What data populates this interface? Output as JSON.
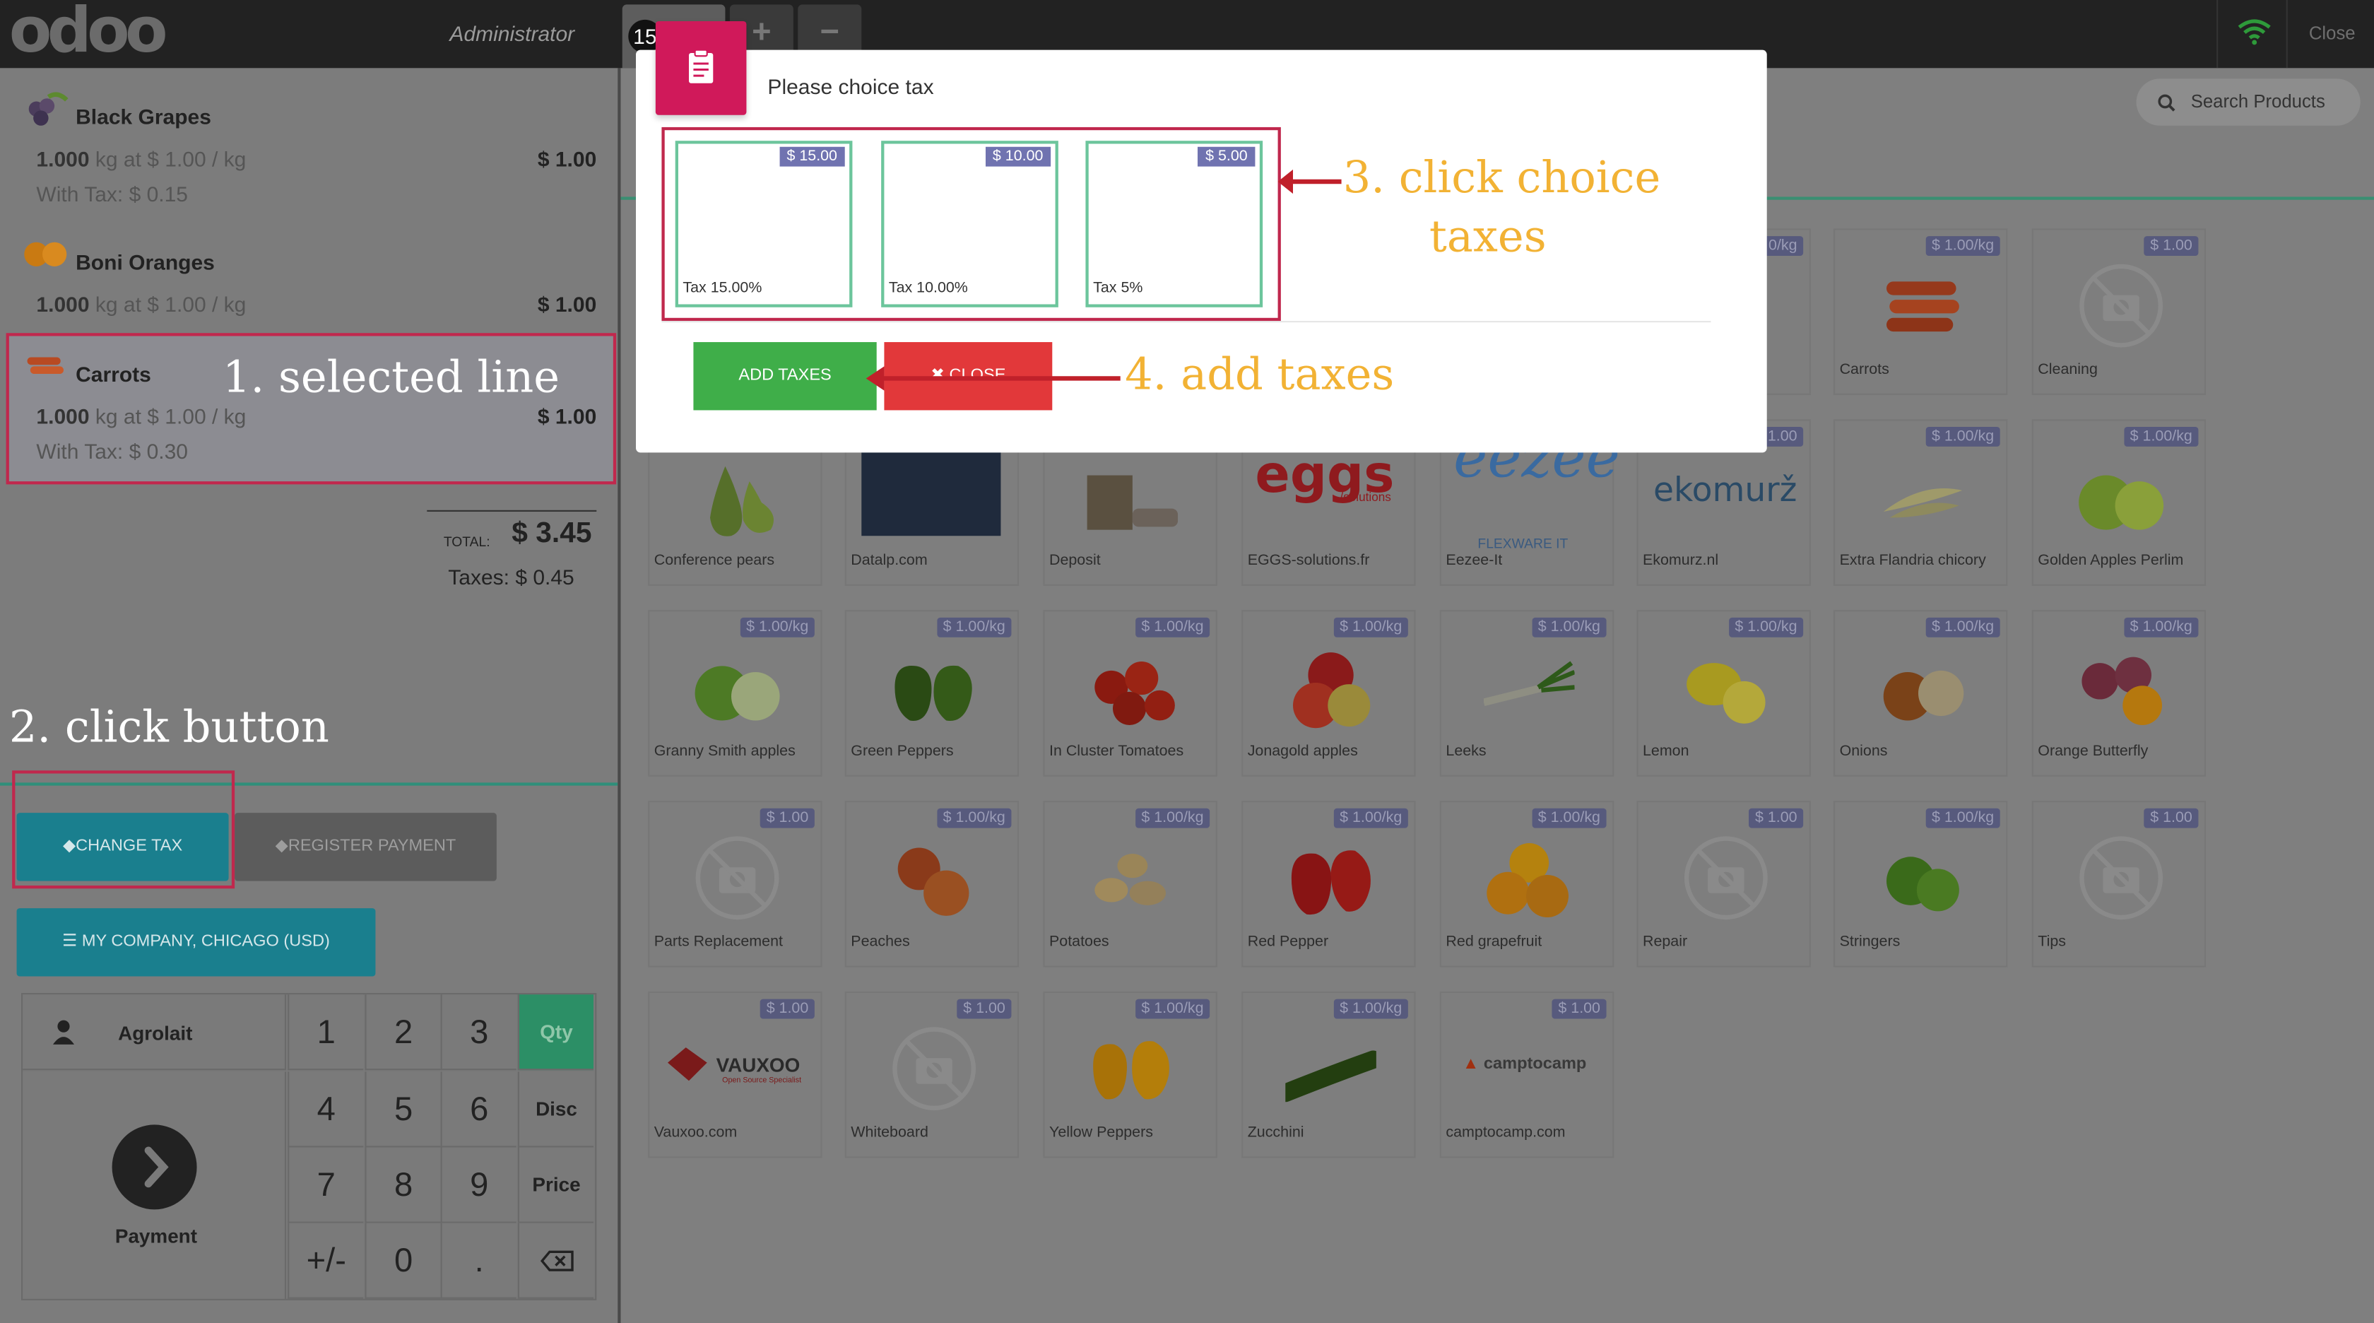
{
  "header": {
    "logo": "odoo",
    "user": "Administrator",
    "order_number": "15",
    "add_tab": "+",
    "remove_tab": "−",
    "close": "Close"
  },
  "order": {
    "lines": [
      {
        "name": "Black Grapes",
        "qty": "1.000",
        "unit_text": "kg at $ 1.00 / kg",
        "price": "$ 1.00",
        "tax": "With Tax: $ 0.15"
      },
      {
        "name": "Boni Oranges",
        "qty": "1.000",
        "unit_text": "kg at $ 1.00 / kg",
        "price": "$ 1.00",
        "tax": ""
      },
      {
        "name": "Carrots",
        "qty": "1.000",
        "unit_text": "kg at $ 1.00 / kg",
        "price": "$ 1.00",
        "tax": "With Tax: $ 0.30"
      }
    ],
    "total_label": "TOTAL:",
    "total": "$ 3.45",
    "taxes": "Taxes: $ 0.45"
  },
  "actions": {
    "change_tax": "CHANGE TAX",
    "register_payment": "REGISTER PAYMENT",
    "company": "MY COMPANY, CHICAGO (USD)"
  },
  "numpad": {
    "customer": "Agrolait",
    "payment": "Payment",
    "keys": [
      "1",
      "2",
      "3",
      "4",
      "5",
      "6",
      "7",
      "8",
      "9",
      "+/-",
      "0",
      "."
    ],
    "modes": [
      "Qty",
      "Disc",
      "Price"
    ]
  },
  "search": {
    "placeholder": "Search Products"
  },
  "products": [
    {
      "name": "Carrots",
      "price": "$ 1.00/kg"
    },
    {
      "name": "Cleaning",
      "price": "$ 1.00"
    },
    {
      "name": "Conference pears",
      "price": ""
    },
    {
      "name": "Datalp.com",
      "price": ""
    },
    {
      "name": "Deposit",
      "price": ""
    },
    {
      "name": "EGGS-solutions.fr",
      "price": ""
    },
    {
      "name": "Eezee-It",
      "price": ""
    },
    {
      "name": "Ekomurz.nl",
      "price": "1.00"
    },
    {
      "name": "Extra Flandria chicory",
      "price": "$ 1.00/kg"
    },
    {
      "name": "Golden Apples Perlim",
      "price": "$ 1.00/kg"
    },
    {
      "name": "Granny Smith apples",
      "price": "$ 1.00/kg"
    },
    {
      "name": "Green Peppers",
      "price": "$ 1.00/kg"
    },
    {
      "name": "In Cluster Tomatoes",
      "price": "$ 1.00/kg"
    },
    {
      "name": "Jonagold apples",
      "price": "$ 1.00/kg"
    },
    {
      "name": "Leeks",
      "price": "$ 1.00/kg"
    },
    {
      "name": "Lemon",
      "price": "$ 1.00/kg"
    },
    {
      "name": "Onions",
      "price": "$ 1.00/kg"
    },
    {
      "name": "Orange Butterfly",
      "price": "$ 1.00/kg"
    },
    {
      "name": "Parts Replacement",
      "price": "$ 1.00"
    },
    {
      "name": "Peaches",
      "price": "$ 1.00/kg"
    },
    {
      "name": "Potatoes",
      "price": "$ 1.00/kg"
    },
    {
      "name": "Red Pepper",
      "price": "$ 1.00/kg"
    },
    {
      "name": "Red grapefruit",
      "price": "$ 1.00/kg"
    },
    {
      "name": "Repair",
      "price": "$ 1.00"
    },
    {
      "name": "Stringers",
      "price": "$ 1.00/kg"
    },
    {
      "name": "Tips",
      "price": "$ 1.00"
    },
    {
      "name": "Vauxoo.com",
      "price": "$ 1.00"
    },
    {
      "name": "Whiteboard",
      "price": "$ 1.00"
    },
    {
      "name": "Yellow Peppers",
      "price": "$ 1.00/kg"
    },
    {
      "name": "Zucchini",
      "price": "$ 1.00/kg"
    },
    {
      "name": "camptocamp.com",
      "price": "$ 1.00"
    }
  ],
  "product_partial": {
    "price": "0/kg"
  },
  "modal": {
    "title": "Please choice tax",
    "taxes": [
      {
        "amount": "$ 15.00",
        "name": "Tax 15.00%"
      },
      {
        "amount": "$ 10.00",
        "name": "Tax 10.00%"
      },
      {
        "amount": "$ 5.00",
        "name": "Tax 5%"
      }
    ],
    "add_taxes": "ADD TAXES",
    "close": "CLOSE"
  },
  "annotations": {
    "step1": "1. selected line",
    "step2": "2. click button",
    "step3_line1": "3. click choice",
    "step3_line2": "taxes",
    "step4": "4. add taxes"
  },
  "logos": {
    "eggs": "eggs",
    "eggs_sub": "/solutions",
    "eezee": "eezee",
    "eezee_sub": "FLEXWARE IT",
    "ekomurz": "ekomurž",
    "vauxoo": "VAUXOO",
    "vauxoo_sub": "Open Source Specialist",
    "camptocamp": "camptocamp"
  },
  "colors": {
    "accent_pink": "#d0195a",
    "highlight_red": "#c0284d",
    "add_green": "#3fae49",
    "close_red": "#e2383a",
    "teal": "#1a7f8e",
    "annotation_yellow": "#f2b234"
  }
}
